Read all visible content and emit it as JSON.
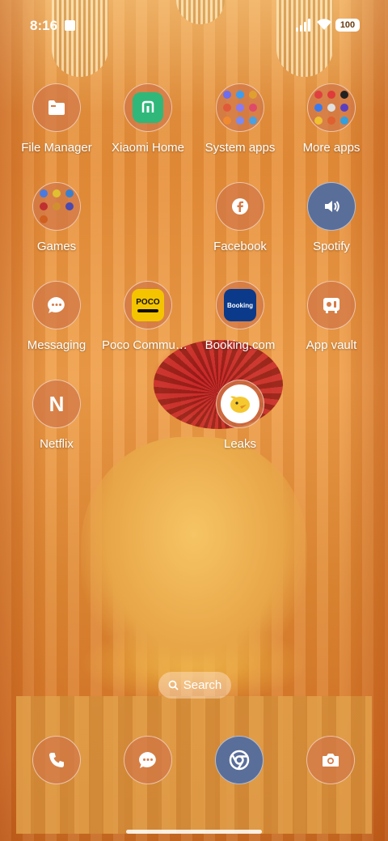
{
  "status_bar": {
    "time": "8:16",
    "battery": "100"
  },
  "apps": {
    "file_manager": "File Manager",
    "xiaomi_home": "Xiaomi Home",
    "system_apps": "System apps",
    "more_apps": "More apps",
    "games": "Games",
    "facebook": "Facebook",
    "spotify": "Spotify",
    "messaging": "Messaging",
    "poco_community": "Poco Communi...",
    "booking": "Booking.com",
    "app_vault": "App vault",
    "netflix": "Netflix",
    "leaks": "Leaks"
  },
  "icon_text": {
    "poco": "POCO",
    "booking": "Booking",
    "netflix": "N"
  },
  "search": {
    "label": "Search"
  },
  "colors": {
    "icon_bg": "#d2784699",
    "spotify_bg": "#5a6e9a",
    "chrome_bg": "#5a6e9a",
    "xiaomi_green": "#2fb87a",
    "poco_yellow": "#f5c400",
    "booking_blue": "#0b3a8a"
  }
}
